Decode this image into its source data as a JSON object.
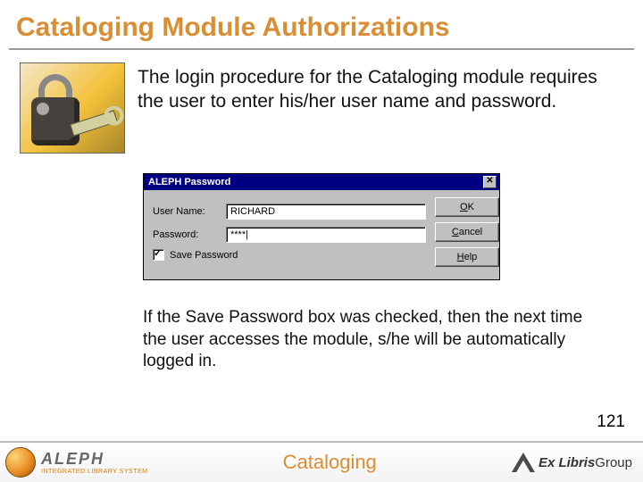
{
  "title": "Cataloging Module Authorizations",
  "intro": "The login procedure for the Cataloging module requires the user to enter his/her user name and password.",
  "dialog": {
    "title": "ALEPH Password",
    "close_glyph": "✕",
    "username_label": "User Name:",
    "username_value": "RICHARD",
    "password_label": "Password:",
    "password_value": "****|",
    "save_label": "Save Password",
    "buttons": {
      "ok": {
        "pre": "",
        "u": "O",
        "post": "K"
      },
      "cancel": {
        "pre": "",
        "u": "C",
        "post": "ancel"
      },
      "help": {
        "pre": "",
        "u": "H",
        "post": "elp"
      }
    }
  },
  "note": "If the Save Password box was checked, then the next time the user accesses the module, s/he will be automatically logged in.",
  "page_number": "121",
  "footer": {
    "aleph": "ALEPH",
    "aleph_sub": "INTEGRATED LIBRARY SYSTEM",
    "center": "Cataloging",
    "exlibris_em": "Ex Libris",
    "exlibris_rest": " Group"
  }
}
